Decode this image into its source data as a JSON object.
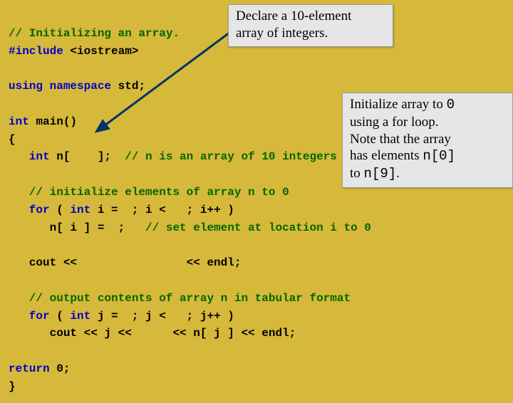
{
  "code": {
    "l01": "// Initializing an array.",
    "l02_a": "#include",
    "l02_b": " <iostream>",
    "l04_a": "using namespace",
    "l04_b": " std;",
    "l06_a": "int",
    "l06_b": " main()",
    "l07": "{",
    "l08_a": "   int",
    "l08_b": " n[    ];  ",
    "l08_c": "// n is an array of 10 integers",
    "l10": "   // initialize elements of array n to 0",
    "l11_a": "   for",
    "l11_b": " ( ",
    "l11_c": "int",
    "l11_d": " i =  ; i <   ; i++ )",
    "l12": "      n[ i ] =  ;   ",
    "l12_c": "// set element at location i to 0",
    "l14": "   cout <<                << endl;",
    "l16": "   // output contents of array n in tabular format",
    "l17_a": "   for",
    "l17_b": " ( ",
    "l17_c": "int",
    "l17_d": " j =  ; j <   ; j++ )",
    "l18": "      cout << j <<      << n[ j ] << endl;",
    "l20_a": "return",
    "l20_b": " 0;",
    "l21": "}"
  },
  "callout1": {
    "line1": "Declare a 10-element",
    "line2": "array of integers."
  },
  "callout2": {
    "line1": "Initialize array to ",
    "zero": "0",
    "line2": "using a for loop.",
    "line3": "Note that the array",
    "line4a": "has elements ",
    "n0": "n[0]",
    "line5a": "to ",
    "n9": "n[9]",
    "dot": "."
  }
}
